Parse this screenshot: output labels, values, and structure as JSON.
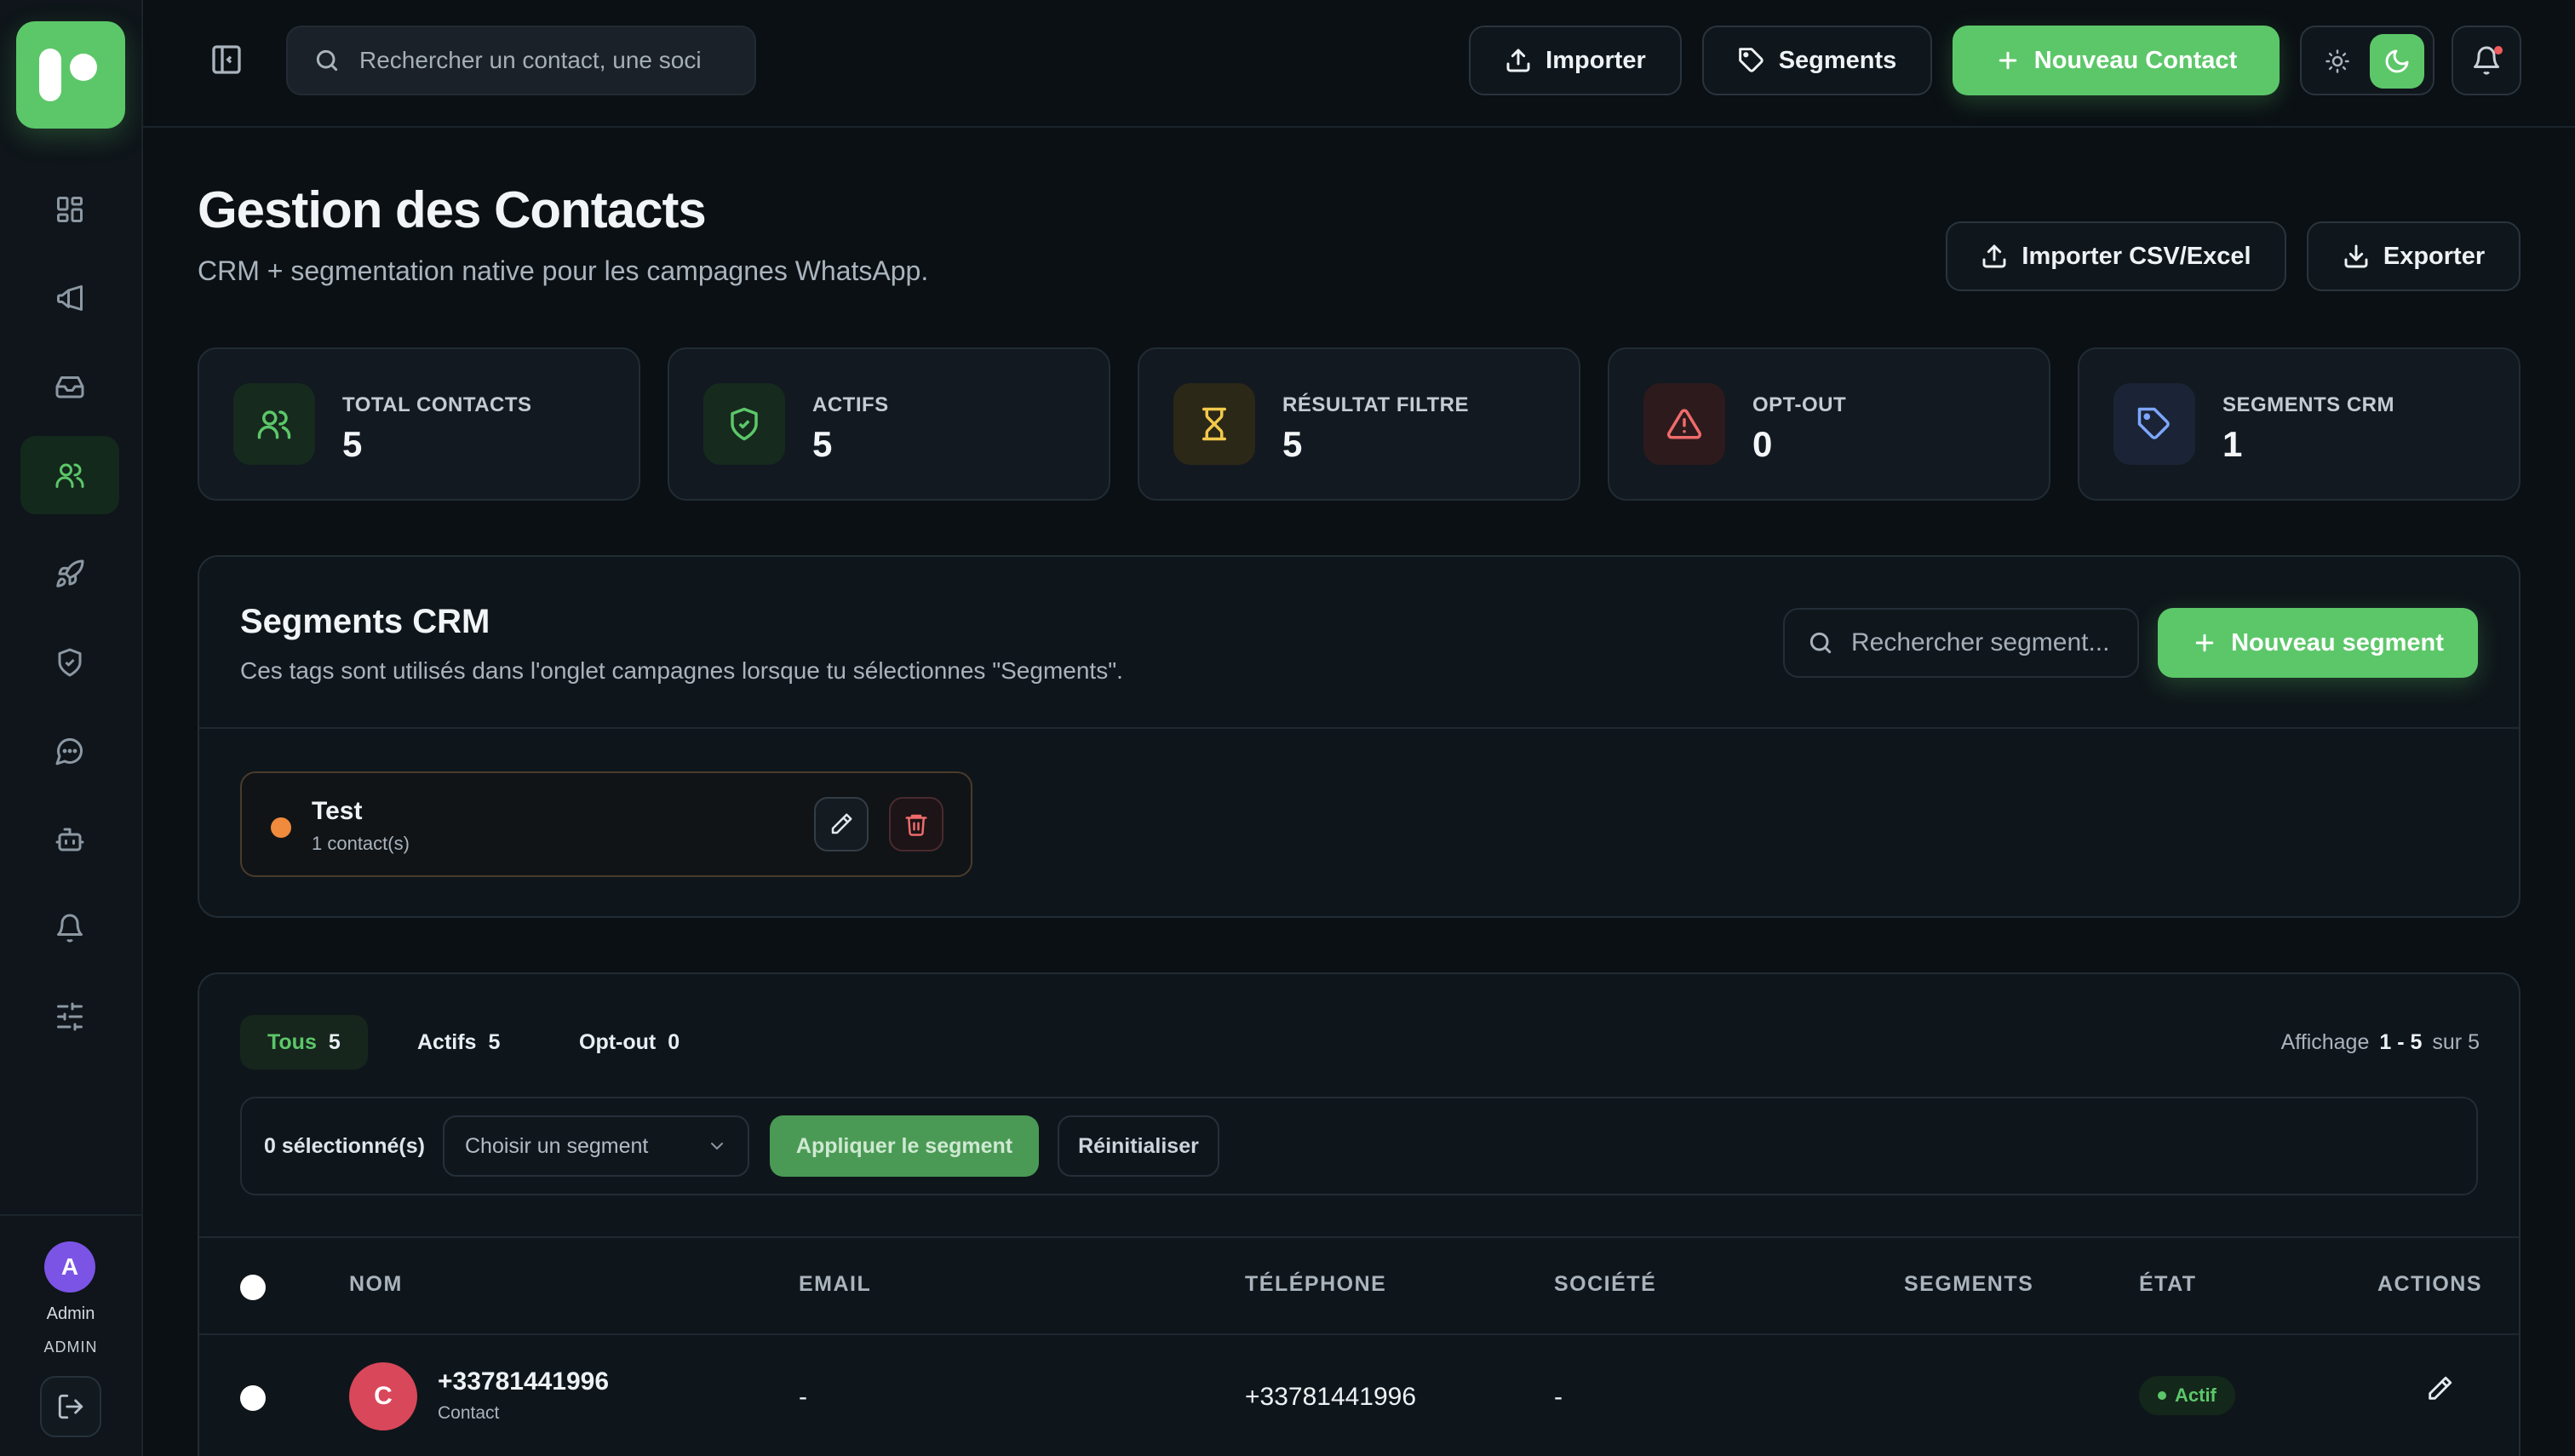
{
  "topbar": {
    "search_placeholder": "Rechercher un contact, une soci",
    "import_label": "Importer",
    "segments_label": "Segments",
    "new_contact_label": "Nouveau Contact"
  },
  "sidebar": {
    "items": [
      {
        "name": "dashboard",
        "icon": "grid-icon",
        "active": false
      },
      {
        "name": "campaigns",
        "icon": "megaphone-icon",
        "active": false
      },
      {
        "name": "inbox",
        "icon": "inbox-icon",
        "active": false
      },
      {
        "name": "contacts",
        "icon": "users-icon",
        "active": true
      },
      {
        "name": "launch",
        "icon": "rocket-icon",
        "active": false
      },
      {
        "name": "security",
        "icon": "shield-icon",
        "active": false
      },
      {
        "name": "messages",
        "icon": "chat-icon",
        "active": false
      },
      {
        "name": "bots",
        "icon": "bot-icon",
        "active": false
      },
      {
        "name": "notifications",
        "icon": "bell-icon",
        "active": false
      },
      {
        "name": "settings",
        "icon": "sliders-icon",
        "active": false
      }
    ],
    "user": {
      "initial": "A",
      "name": "Admin",
      "role": "ADMIN"
    }
  },
  "header": {
    "title": "Gestion des Contacts",
    "subtitle": "CRM + segmentation native pour les campagnes WhatsApp.",
    "import_csv_label": "Importer CSV/Excel",
    "export_label": "Exporter"
  },
  "stats": [
    {
      "label": "TOTAL CONTACTS",
      "value": "5",
      "icon": "users-icon",
      "color": "#5cc769",
      "bg": "#162a1e"
    },
    {
      "label": "ACTIFS",
      "value": "5",
      "icon": "shield-check-icon",
      "color": "#5cc769",
      "bg": "#162a1e"
    },
    {
      "label": "RÉSULTAT FILTRE",
      "value": "5",
      "icon": "hourglass-icon",
      "color": "#f2c94c",
      "bg": "#2c2817"
    },
    {
      "label": "OPT-OUT",
      "value": "0",
      "icon": "warning-icon",
      "color": "#ef6b6b",
      "bg": "#2d1a1c"
    },
    {
      "label": "SEGMENTS CRM",
      "value": "1",
      "icon": "tag-icon",
      "color": "#7ea7ff",
      "bg": "#1a2436"
    }
  ],
  "segments_panel": {
    "title": "Segments CRM",
    "description": "Ces tags sont utilisés dans l'onglet campagnes lorsque tu sélectionnes \"Segments\".",
    "search_placeholder": "Rechercher segment...",
    "new_segment_label": "Nouveau segment",
    "items": [
      {
        "name": "Test",
        "count": "1 contact(s)",
        "color": "#f08a3c"
      }
    ]
  },
  "contacts_panel": {
    "tabs": [
      {
        "label": "Tous",
        "count": "5",
        "active": true
      },
      {
        "label": "Actifs",
        "count": "5",
        "active": false
      },
      {
        "label": "Opt-out",
        "count": "0",
        "active": false
      }
    ],
    "pagination": {
      "prefix": "Affichage",
      "range": "1 - 5",
      "suffix": "sur 5"
    },
    "bulk": {
      "selected": "0 sélectionné(s)",
      "segment_select": "Choisir un segment",
      "apply_label": "Appliquer le segment",
      "reset_label": "Réinitialiser"
    },
    "columns": [
      "NOM",
      "EMAIL",
      "TÉLÉPHONE",
      "SOCIÉTÉ",
      "SEGMENTS",
      "ÉTAT",
      "ACTIONS"
    ],
    "rows": [
      {
        "initial": "C",
        "name": "+33781441996",
        "type": "Contact",
        "email": "-",
        "phone": "+33781441996",
        "company": "-",
        "segments": "",
        "status": "Actif"
      }
    ]
  },
  "colors": {
    "accent": "#5cc769",
    "background": "#0b1014",
    "panel": "#0f161b",
    "avatar_row": "#d9475a",
    "avatar_user": "#7b54e6"
  }
}
